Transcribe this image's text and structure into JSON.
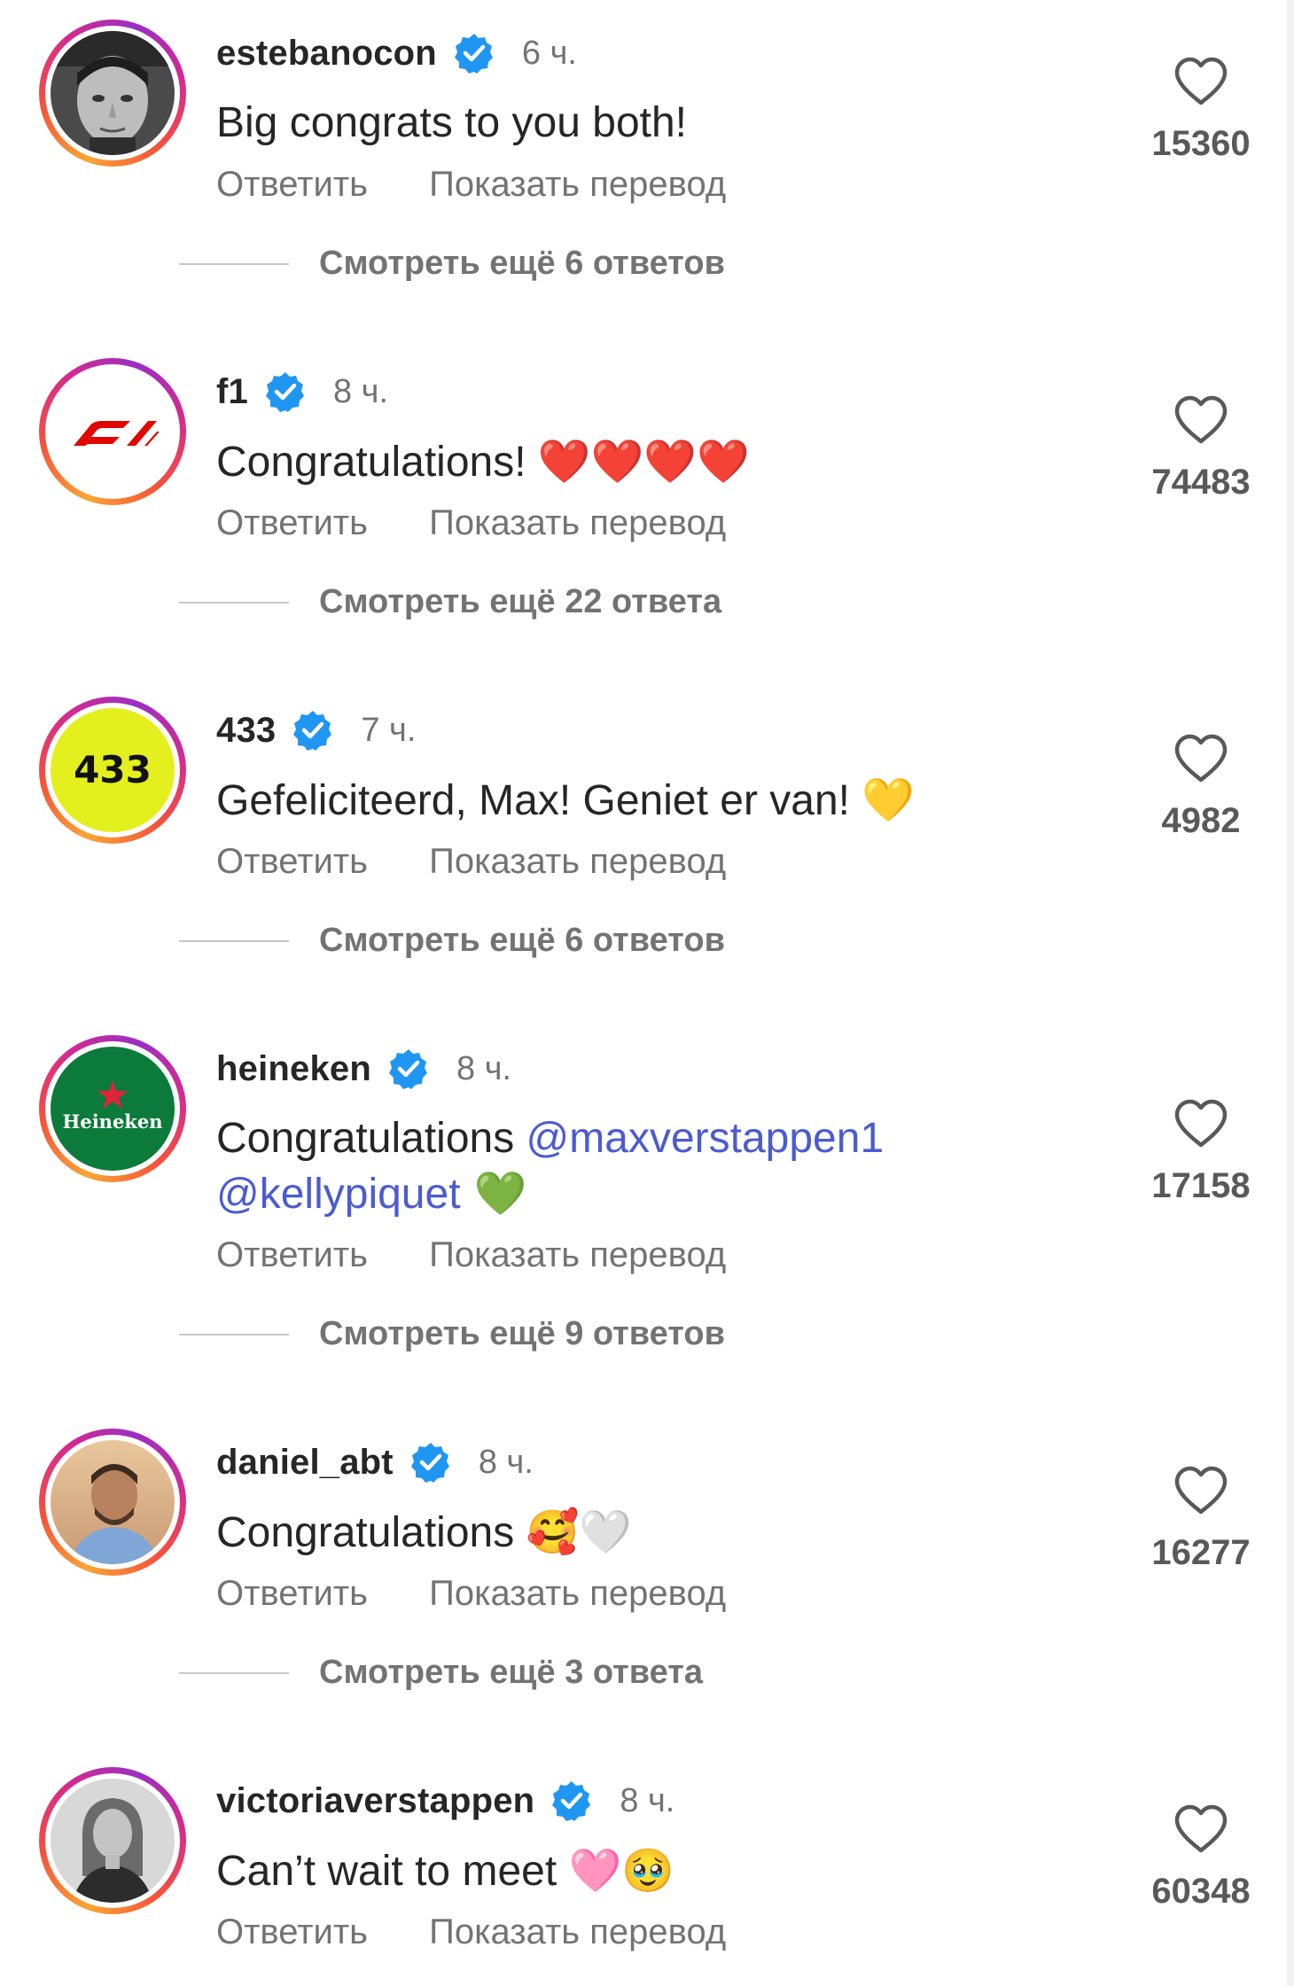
{
  "colors": {
    "verified": "#2096f3",
    "mention": "#4b5bd1",
    "muted": "#737373"
  },
  "comments": [
    {
      "username": "estebanocon",
      "time": "6 ч.",
      "text_parts": [
        "Big congrats to you both!"
      ],
      "reply_label": "Ответить",
      "translate_label": "Показать перевод",
      "replies_label": "Смотреть ещё 6 ответов",
      "likes": "15360",
      "avatar": "portrait-photo"
    },
    {
      "username": "f1",
      "time": "8 ч.",
      "text_parts": [
        "Congratulations! ",
        "❤️❤️❤️❤️"
      ],
      "reply_label": "Ответить",
      "translate_label": "Показать перевод",
      "replies_label": "Смотреть ещё 22 ответа",
      "likes": "74483",
      "avatar": "f1-logo"
    },
    {
      "username": "433",
      "time": "7 ч.",
      "text_parts": [
        "Gefeliciteerd, Max! Geniet er van! ",
        "💛"
      ],
      "reply_label": "Ответить",
      "translate_label": "Показать перевод",
      "replies_label": "Смотреть ещё 6 ответов",
      "likes": "4982",
      "avatar": "433-logo",
      "avatar_text": "433"
    },
    {
      "username": "heineken",
      "time": "8 ч.",
      "text_parts": [
        "Congratulations ",
        "@maxverstappen1",
        "@kellypiquet",
        " 💚"
      ],
      "reply_label": "Ответить",
      "translate_label": "Показать перевод",
      "replies_label": "Смотреть ещё 9 ответов",
      "likes": "17158",
      "avatar": "heineken-logo",
      "avatar_text": "Heineken"
    },
    {
      "username": "daniel_abt",
      "time": "8 ч.",
      "text_parts": [
        "Congratulations ",
        "🥰🤍"
      ],
      "reply_label": "Ответить",
      "translate_label": "Показать перевод",
      "replies_label": "Смотреть ещё 3 ответа",
      "likes": "16277",
      "avatar": "portrait-photo"
    },
    {
      "username": "victoriaverstappen",
      "time": "8 ч.",
      "text_parts": [
        "Can’t wait to meet ",
        "🩷🥹"
      ],
      "reply_label": "Ответить",
      "translate_label": "Показать перевод",
      "likes": "60348",
      "avatar": "portrait-photo"
    }
  ]
}
